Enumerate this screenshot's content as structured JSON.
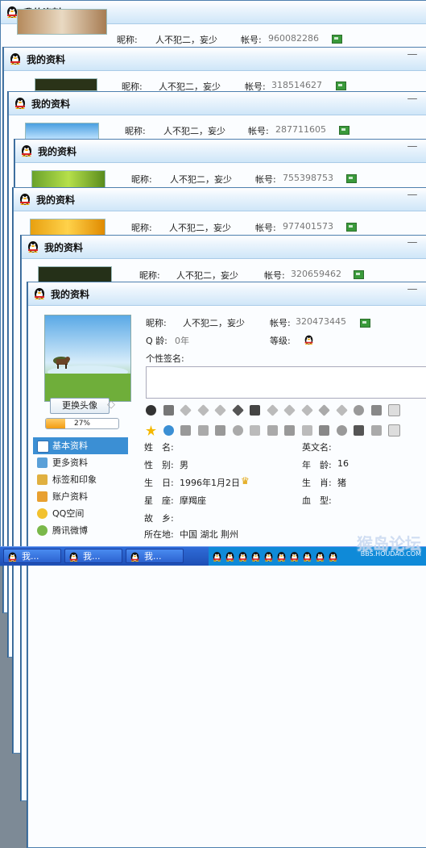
{
  "windows": [
    {
      "title": "我的资料",
      "nickname_label": "昵称:",
      "nickname": "人不犯二，妄少",
      "account_label": "帐号:",
      "account": "960082286"
    },
    {
      "title": "我的资料",
      "nickname_label": "昵称:",
      "nickname": "人不犯二，妄少",
      "account_label": "帐号:",
      "account": "318514627"
    },
    {
      "title": "我的资料",
      "nickname_label": "昵称:",
      "nickname": "人不犯二，妄少",
      "account_label": "帐号:",
      "account": "287711605"
    },
    {
      "title": "我的资料",
      "nickname_label": "昵称:",
      "nickname": "人不犯二，妄少",
      "account_label": "帐号:",
      "account": "755398753"
    },
    {
      "title": "我的资料",
      "nickname_label": "昵称:",
      "nickname": "人不犯二，妄少",
      "account_label": "帐号:",
      "account": "977401573"
    },
    {
      "title": "我的资料",
      "nickname_label": "昵称:",
      "nickname": "人不犯二，妄少",
      "account_label": "帐号:",
      "account": "320659462"
    }
  ],
  "front": {
    "title": "我的资料",
    "nickname_label": "昵称:",
    "nickname": "人不犯二，妄少",
    "account_label": "帐号:",
    "account": "320473445",
    "qage_label": "Q 龄:",
    "qage": "0年",
    "level_label": "等级:",
    "signature_label": "个性签名:",
    "change_avatar": "更换头像",
    "progress_text": "27%",
    "progress_value": 0.27,
    "nav": [
      {
        "label": "基本资料",
        "icon": "id-card-icon",
        "selected": true
      },
      {
        "label": "更多资料",
        "icon": "more-info-icon",
        "selected": false
      },
      {
        "label": "标签和印象",
        "icon": "tag-icon",
        "selected": false
      },
      {
        "label": "账户资料",
        "icon": "account-icon",
        "selected": false
      },
      {
        "label": "QQ空间",
        "icon": "qzone-star-icon",
        "selected": false
      },
      {
        "label": "腾讯微博",
        "icon": "weibo-icon",
        "selected": false
      }
    ],
    "profile": {
      "name_label": "姓　名:",
      "english_name_label": "英文名:",
      "gender_label": "性　别:",
      "gender": "男",
      "age_label": "年　龄:",
      "age": "16",
      "birthday_label": "生　日:",
      "birthday": "1996年1月2日",
      "zodiac_animal_label": "生　肖:",
      "zodiac_animal": "猪",
      "star_sign_label": "星　座:",
      "star_sign": "摩羯座",
      "blood_label": "血　型:",
      "hometown_label": "故　乡:",
      "location_label": "所在地:",
      "location": "中国  湖北  荆州"
    }
  },
  "taskbar": {
    "buttons": [
      "我...",
      "我...",
      "我..."
    ],
    "watermark": "猴岛论坛",
    "watermark_site": "BBS.HOUDAO.COM"
  },
  "colors": {
    "accent": "#3b8fd4",
    "title_grad_bottom": "#cfe6f8",
    "progress": "#f39c12"
  }
}
